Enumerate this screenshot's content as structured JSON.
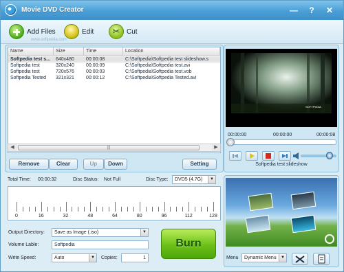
{
  "window": {
    "title": "Movie DVD Creator",
    "controls": [
      "minimize-icon",
      "help-icon",
      "close-icon"
    ]
  },
  "toolbar": {
    "add_files": "Add Files",
    "edit": "Edit",
    "cut": "Cut",
    "watermark": "www.softpedia.com"
  },
  "file_list": {
    "columns": [
      "Name",
      "Size",
      "Time",
      "Location"
    ],
    "rows": [
      {
        "name": "Softpedia test s...",
        "size": "640x480",
        "time": "00:00:08",
        "location": "C:\\Softpedia\\Softpedia test slideshow.s",
        "selected": true
      },
      {
        "name": "Softpedia test",
        "size": "320x240",
        "time": "00:00:09",
        "location": "C:\\Softpedia\\Softpedia test.avi",
        "selected": false
      },
      {
        "name": "Softpedia test",
        "size": "720x576",
        "time": "00:00:03",
        "location": "C:\\Softpedia\\Softpedia test.vob",
        "selected": false
      },
      {
        "name": "Softpedia Tested",
        "size": "321x321",
        "time": "00:00:12",
        "location": "C:\\Softpedia\\Softpedia Tested.avi",
        "selected": false
      }
    ]
  },
  "list_buttons": {
    "remove": "Remove",
    "clear": "Clear",
    "up": "Up",
    "down": "Down",
    "setting": "Setting"
  },
  "disc_info": {
    "total_time_label": "Total Time:",
    "total_time": "00:00:32",
    "disc_status_label": "Disc Status:",
    "disc_status": "Not Full",
    "disc_type_label": "Disc Type:",
    "disc_type": "DVD5 (4.7G)"
  },
  "ruler": {
    "labels": [
      "0",
      "16",
      "32",
      "48",
      "64",
      "80",
      "96",
      "112",
      "128"
    ]
  },
  "output": {
    "directory_label": "Output Directory:",
    "directory_value": "Save as Image (.iso)",
    "volume_label_label": "Volume Lable:",
    "volume_label_value": "Softpedia",
    "write_speed_label": "Write Speed:",
    "write_speed_value": "Auto",
    "copies_label": "Copies:",
    "copies_value": "1"
  },
  "burn_label": "Burn",
  "preview": {
    "time_start": "00:00:00",
    "time_current": "00:00:00",
    "time_end": "00:00:08",
    "caption": "Softpedia test slideshow",
    "overlay_text": "SOFTPEDIA",
    "playback_position": 0,
    "volume_level": 0.8
  },
  "menu": {
    "label": "Menu",
    "value": "Dynamic Menu"
  },
  "colors": {
    "accent": "#4a9fd6",
    "burn": "#6cc017",
    "background": "#dcedf6"
  }
}
